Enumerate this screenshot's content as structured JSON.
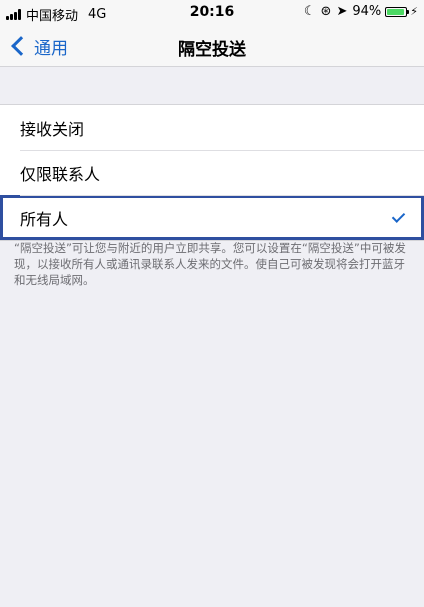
{
  "status_bar": {
    "carrier": "中国移动",
    "network": "4G",
    "time": "20:16",
    "battery_percent": "94%",
    "battery_level": 0.94,
    "battery_color": "#4cd964"
  },
  "nav": {
    "back_label": "通用",
    "title": "隔空投送"
  },
  "options": [
    {
      "label": "接收关闭",
      "selected": false
    },
    {
      "label": "仅限联系人",
      "selected": false
    },
    {
      "label": "所有人",
      "selected": true
    }
  ],
  "footer_note": "“隔空投送”可让您与附近的用户立即共享。您可以设置在“隔空投送”中可被发现，以接收所有人或通讯录联系人发来的文件。使自己可被发现将会打开蓝牙和无线局域网。",
  "icons": {
    "do_not_disturb": "moon-icon",
    "orientation_lock": "orientation-lock-icon",
    "location": "location-arrow-icon",
    "charging": "bolt-icon",
    "selected": "checkmark-icon"
  },
  "colors": {
    "accent": "#1a66c9",
    "highlight_frame": "#2f4fa0",
    "background": "#efeff4"
  }
}
